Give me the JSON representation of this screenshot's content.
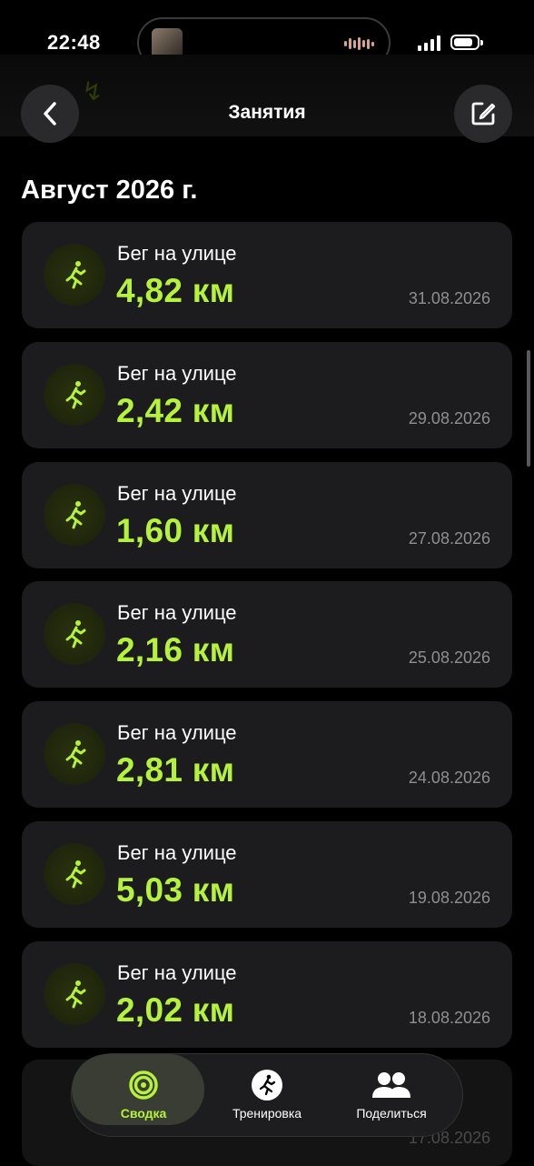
{
  "status_bar": {
    "time": "22:48"
  },
  "nav": {
    "title": "Занятия"
  },
  "section": {
    "title": "Август 2026 г."
  },
  "workouts": [
    {
      "type": "Бег на улице",
      "distance": "4,82 км",
      "date": "31.08.2026"
    },
    {
      "type": "Бег на улице",
      "distance": "2,42 км",
      "date": "29.08.2026"
    },
    {
      "type": "Бег на улице",
      "distance": "1,60 км",
      "date": "27.08.2026"
    },
    {
      "type": "Бег на улице",
      "distance": "2,16 км",
      "date": "25.08.2026"
    },
    {
      "type": "Бег на улице",
      "distance": "2,81 км",
      "date": "24.08.2026"
    },
    {
      "type": "Бег на улице",
      "distance": "5,03 км",
      "date": "19.08.2026"
    },
    {
      "type": "Бег на улице",
      "distance": "2,02 км",
      "date": "18.08.2026"
    }
  ],
  "partial_card": {
    "date": "17.08.2026"
  },
  "tabs": [
    {
      "label": "Сводка",
      "icon": "activity-rings-icon",
      "active": true
    },
    {
      "label": "Тренировка",
      "icon": "running-figure-icon",
      "active": false
    },
    {
      "label": "Поделиться",
      "icon": "people-icon",
      "active": false
    }
  ],
  "colors": {
    "accent": "#b5f23b",
    "card": "#1c1c1e",
    "background": "#000000"
  }
}
